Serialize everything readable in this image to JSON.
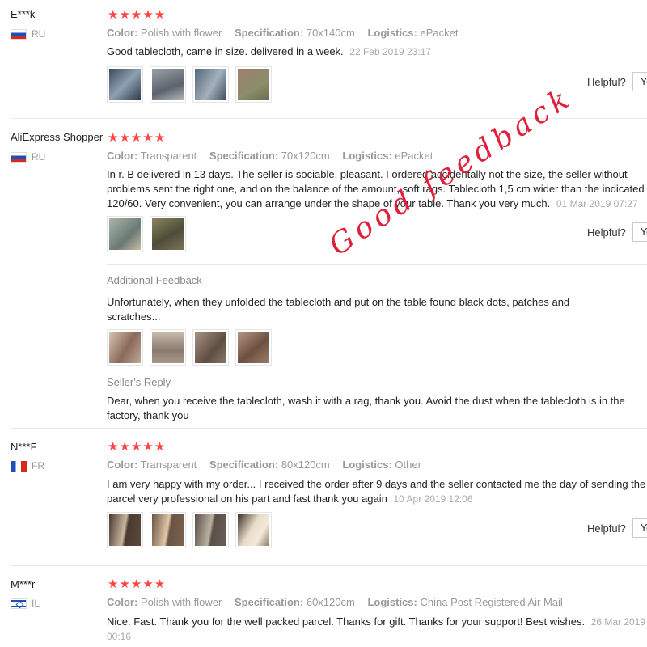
{
  "labels": {
    "color": "Color:",
    "specification": "Specification:",
    "logistics": "Logistics:",
    "helpful": "Helpful?",
    "yes": "Yes"
  },
  "stars": "★★★★★",
  "reviews": [
    {
      "user": "E***k",
      "country": "RU",
      "flag": "ru",
      "color": "Polish with flower",
      "specification": "70x140cm",
      "logistics": "ePacket",
      "text": "Good tablecloth, came in size. delivered in a week.",
      "date": "22 Feb 2019 23:17",
      "images": [
        "#5b6f86",
        "#8a8f96",
        "#6f7d8c",
        "#9a8a70"
      ]
    },
    {
      "user": "AliExpress Shopper",
      "country": "RU",
      "flag": "ru",
      "color": "Transparent",
      "specification": "70x120cm",
      "logistics": "ePacket",
      "text": "In r. B delivered in 13 days. The seller is sociable, pleasant. I ordered accidentally not the size, the seller without problems sent the right one, and on the balance of the amount, soft rags. Tablecloth 1,5 cm wider than the indicated 120/60. Very convenient, you can arrange under the shape of your table. Thank you very much.",
      "date": "01 Mar 2019 07:27",
      "images": [
        "#8a9a92",
        "#6d6a50"
      ],
      "additional_label": "Additional Feedback",
      "additional_text": "Unfortunately, when they unfolded the tablecloth and put on the table found black dots, patches and scratches...",
      "additional_images": [
        "#b89080",
        "#a89a8a",
        "#7a6a5e",
        "#8b6a55"
      ],
      "reply_label": "Seller's Reply",
      "reply_text": "Dear, when you receive the tablecloth, wash it with a rag, thank you. Avoid the dust when the tablecloth is in the factory, thank you"
    },
    {
      "user": "N***F",
      "country": "FR",
      "flag": "fr",
      "color": "Transparent",
      "specification": "80x120cm",
      "logistics": "Other",
      "text": "I am very happy with my order... I received the order after 9 days and the seller contacted me the day of sending the parcel very professional on his part and fast thank you again",
      "date": "10 Apr 2019 12:06",
      "images": [
        "#6a5242",
        "#8a6e55",
        "#6e6355",
        "#b9a890"
      ]
    },
    {
      "user": "M***r",
      "country": "IL",
      "flag": "il",
      "color": "Polish with flower",
      "specification": "60x120cm",
      "logistics": "China Post Registered Air Mail",
      "text": "Nice. Fast. Thank you for the well packed parcel. Thanks for gift. Thanks for your support! Best wishes.",
      "date": "26 Mar 2019 00:16"
    }
  ],
  "watermark": "Good feedback"
}
